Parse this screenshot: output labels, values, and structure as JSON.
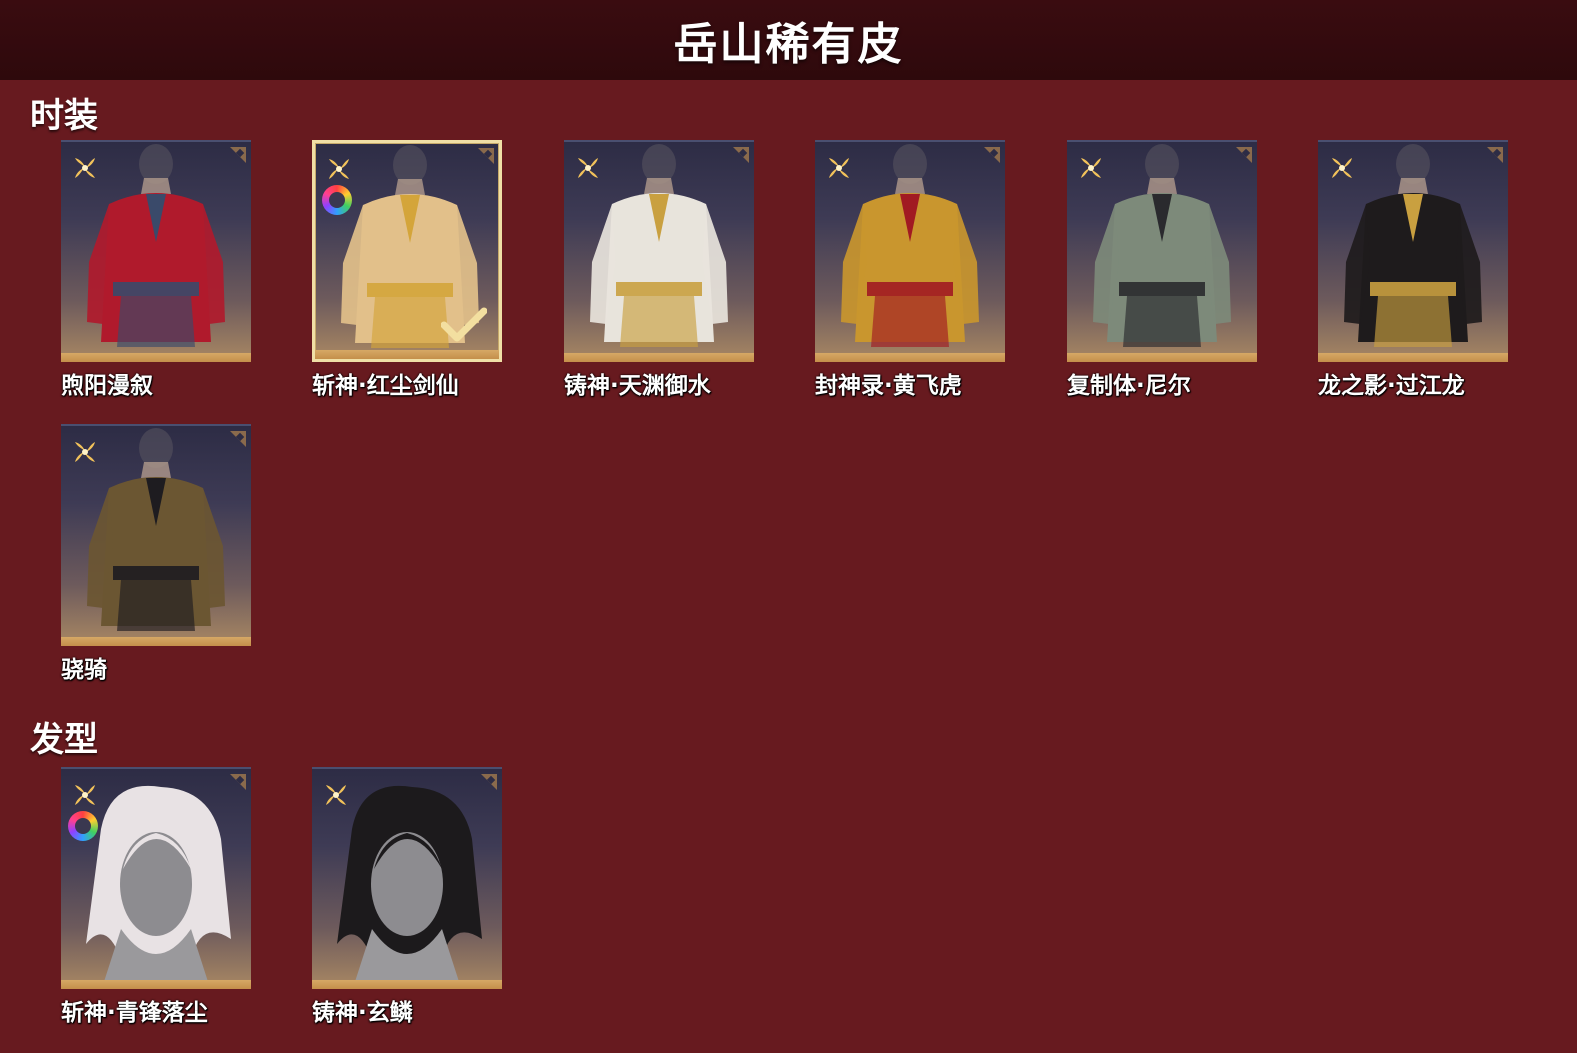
{
  "page_title": "岳山稀有皮",
  "sections": [
    {
      "title": "时装",
      "items": [
        {
          "name": "煦阳漫叙",
          "outfit_color": "#b01a2c",
          "accent": "#3a4a6a"
        },
        {
          "name": "斩神·红尘剑仙",
          "outfit_color": "#e2c08a",
          "accent": "#d4a53a",
          "selected": true,
          "dye_icon": true
        },
        {
          "name": "铸神·天渊御水",
          "outfit_color": "#e8e4dc",
          "accent": "#c9a040"
        },
        {
          "name": "封神录·黄飞虎",
          "outfit_color": "#c9962e",
          "accent": "#a11a22"
        },
        {
          "name": "复制体·尼尔",
          "outfit_color": "#7d8a7a",
          "accent": "#2a2a2e"
        },
        {
          "name": "龙之影·过江龙",
          "outfit_color": "#1e1b1c",
          "accent": "#c9a040"
        },
        {
          "name": "骁骑",
          "outfit_color": "#6b5632",
          "accent": "#1e1c20"
        }
      ]
    },
    {
      "title": "发型",
      "items": [
        {
          "name": "斩神·青锋落尘",
          "hair_color": "#e8e2e4",
          "dye_icon": true
        },
        {
          "name": "铸神·玄鳞",
          "hair_color": "#1c1a1c"
        }
      ]
    }
  ],
  "colors": {
    "background": "#671a1f",
    "header": "#2e090c",
    "card_bottom_bar": "#d6a865",
    "rarity_icon": "#f2c25a",
    "selected_border": "#f0dfa6"
  }
}
